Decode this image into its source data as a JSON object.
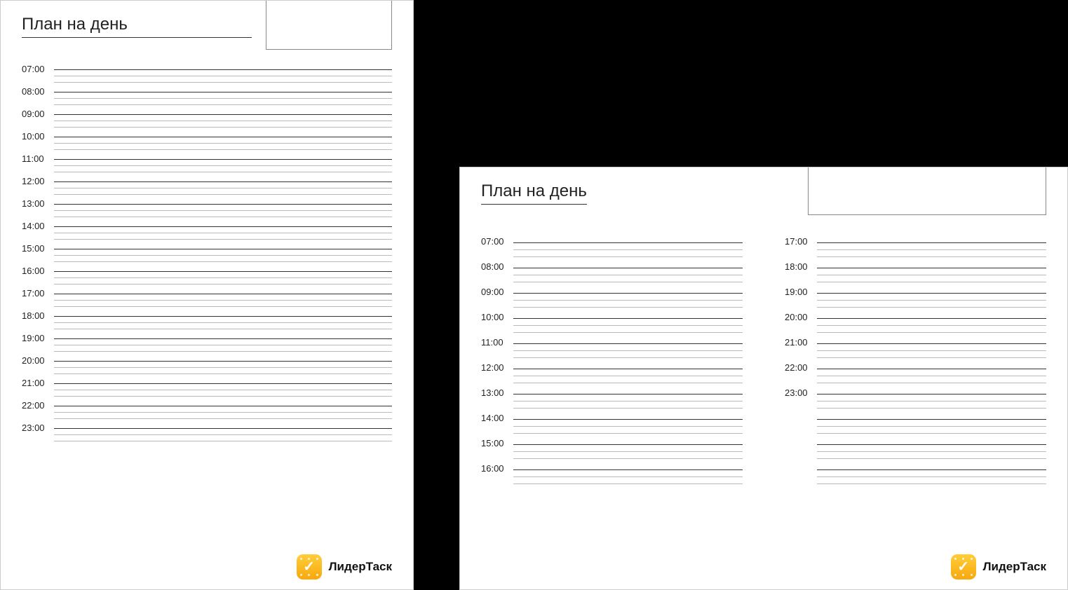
{
  "title": "План на день",
  "brand_name": "ЛидерТаск",
  "left_page": {
    "hours": [
      "07:00",
      "08:00",
      "09:00",
      "10:00",
      "11:00",
      "12:00",
      "13:00",
      "14:00",
      "15:00",
      "16:00",
      "17:00",
      "18:00",
      "19:00",
      "20:00",
      "21:00",
      "22:00",
      "23:00"
    ]
  },
  "right_page": {
    "col1_hours": [
      "07:00",
      "08:00",
      "09:00",
      "10:00",
      "11:00",
      "12:00",
      "13:00",
      "14:00",
      "15:00",
      "16:00"
    ],
    "col2_hours": [
      "17:00",
      "18:00",
      "19:00",
      "20:00",
      "21:00",
      "22:00",
      "23:00"
    ],
    "col2_extra_blank_slots": 3
  }
}
